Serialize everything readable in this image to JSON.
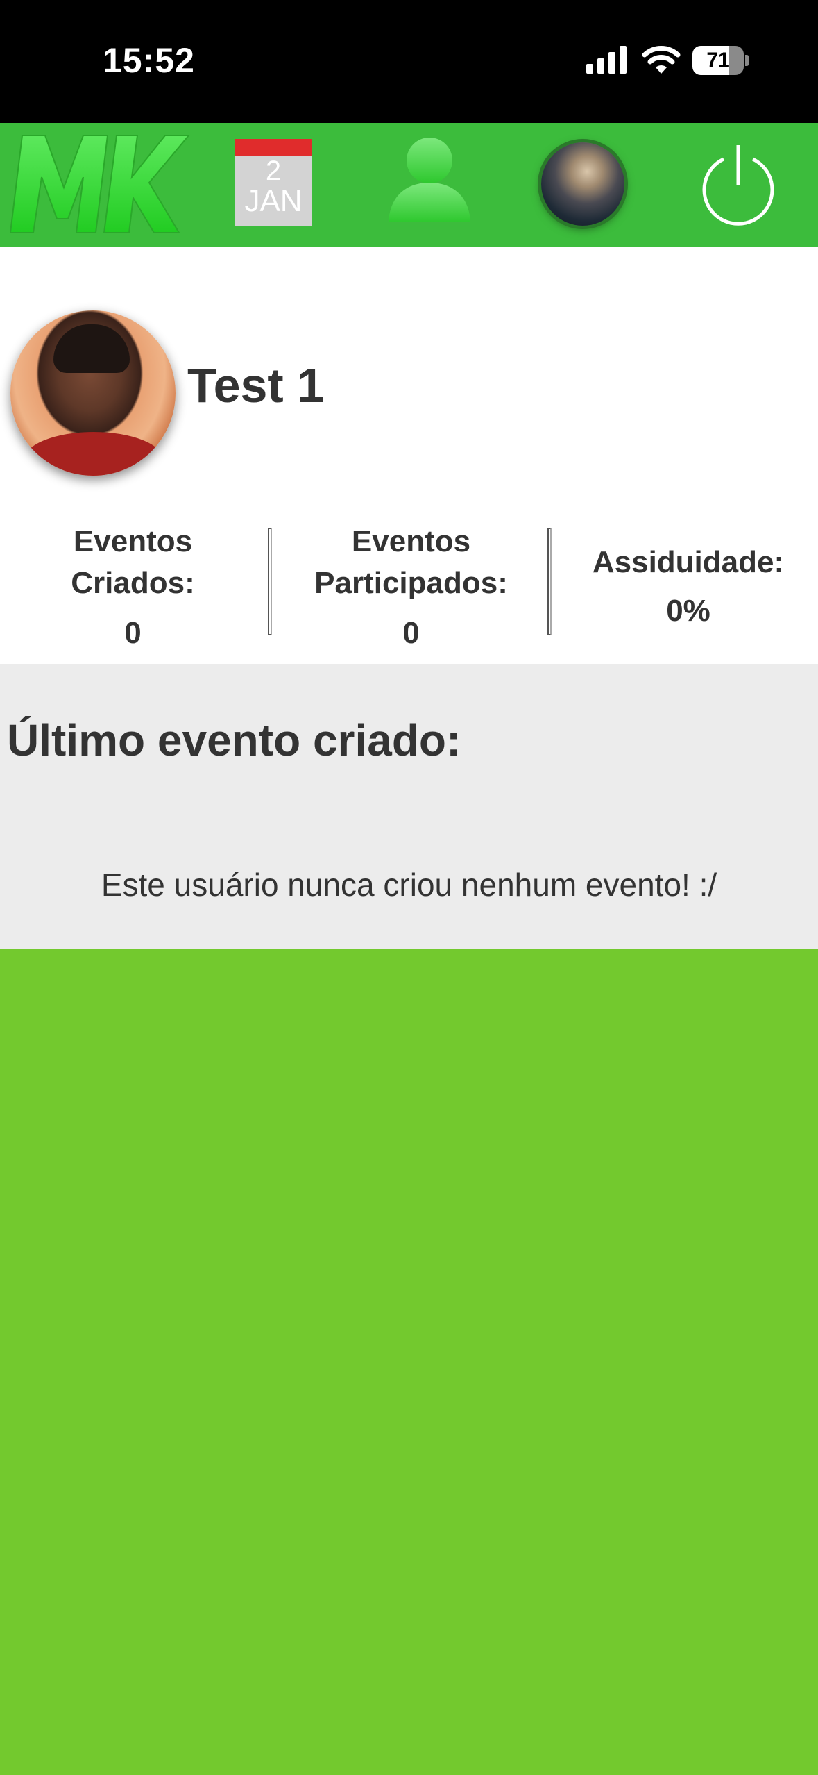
{
  "status_bar": {
    "time": "15:52",
    "battery_level": "71",
    "battery_fraction": 0.71,
    "icons": [
      "signal-icon",
      "wifi-icon",
      "battery-icon"
    ]
  },
  "navbar": {
    "logo_text": "MK",
    "calendar": {
      "day": "2",
      "month": "JAN"
    },
    "icons": [
      "mk-logo",
      "calendar-icon",
      "user-icon",
      "avatar",
      "power-icon"
    ],
    "colors": {
      "background": "#3cbc3c",
      "logo": "#33dd33",
      "calendar_top": "#e02c2c"
    }
  },
  "profile": {
    "name": "Test 1",
    "stats": [
      {
        "label": "Eventos Criados:",
        "value": "0"
      },
      {
        "label": "Eventos Participados:",
        "value": "0"
      },
      {
        "label": "Assiduidade:",
        "value": "0%"
      }
    ]
  },
  "last_event": {
    "title": "Último evento criado:",
    "empty_message": "Este usuário nunca criou nenhum evento! :/"
  },
  "colors": {
    "page_background": "#73c92e",
    "section_background": "#ececec",
    "text": "#333333"
  }
}
